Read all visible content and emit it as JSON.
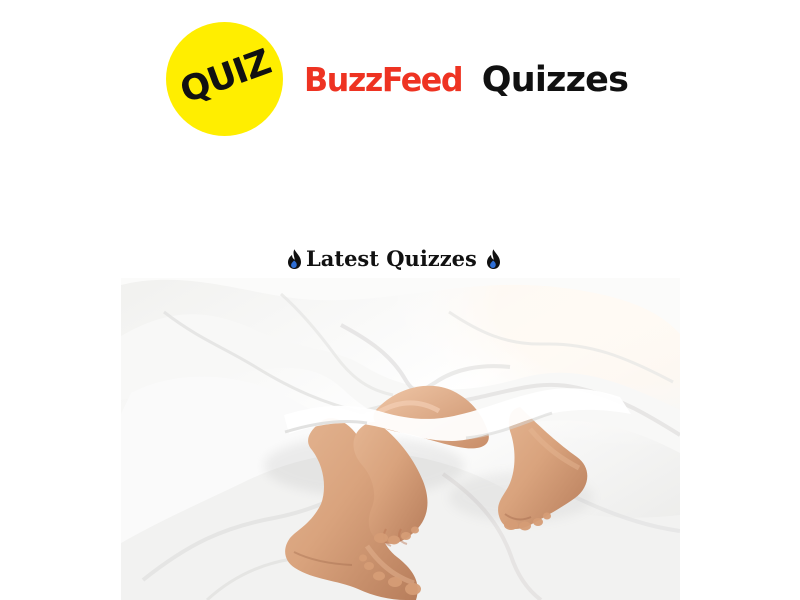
{
  "header": {
    "quiz_badge_text": "QUIZ",
    "brand_name": "BuzzFeed",
    "brand_suffix": "Quizzes"
  },
  "section": {
    "heading": "Latest Quizzes",
    "left_icon": "flame-icon",
    "right_icon": "flame-icon"
  },
  "hero_image": {
    "kind": "photo",
    "subject": "couple-feet-in-white-bed"
  },
  "colors": {
    "background": "#FFFFFF",
    "badge_yellow": "#FFEE00",
    "brand_red": "#EE3322",
    "text_dark": "#111111"
  }
}
